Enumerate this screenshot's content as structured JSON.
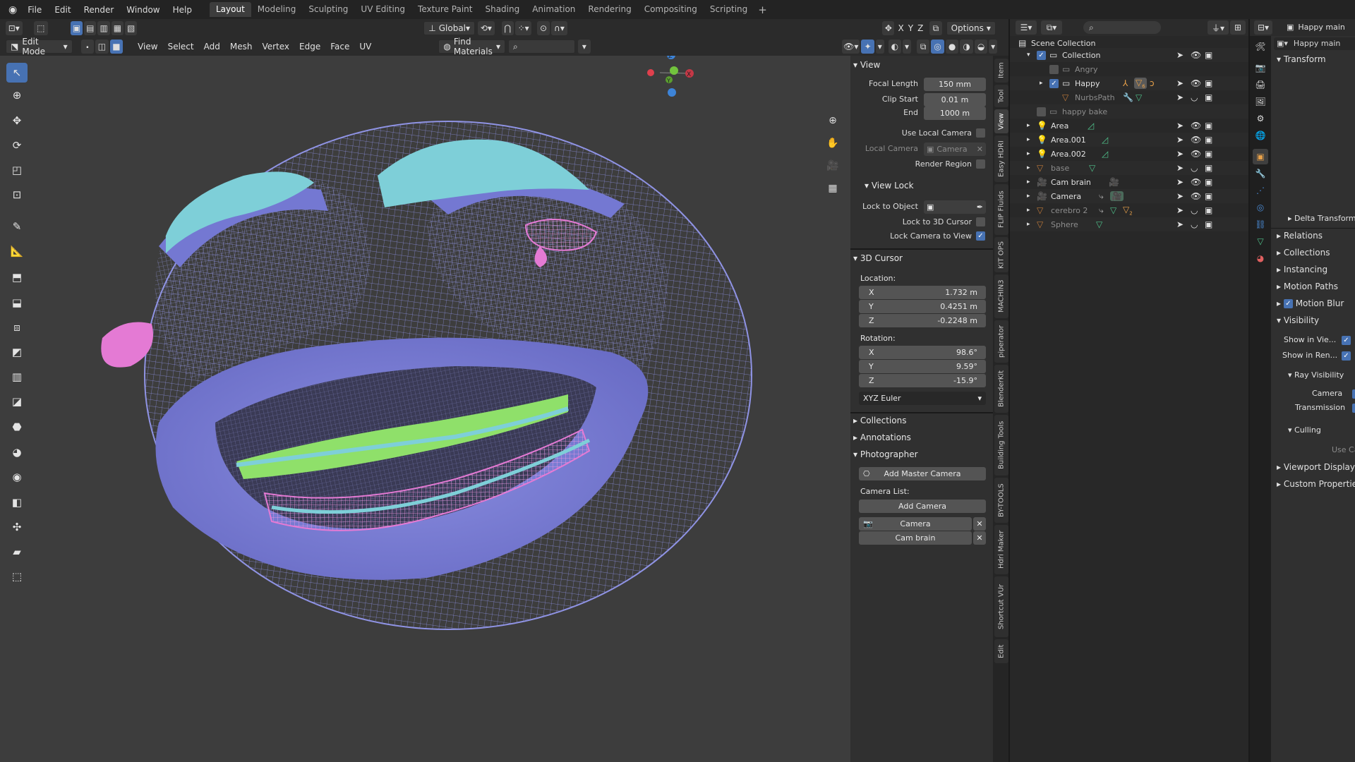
{
  "topbar": {
    "menus": [
      "File",
      "Edit",
      "Render",
      "Window",
      "Help"
    ],
    "workspaces": [
      "Layout",
      "Modeling",
      "Sculpting",
      "UV Editing",
      "Texture Paint",
      "Shading",
      "Animation",
      "Rendering",
      "Compositing",
      "Scripting"
    ],
    "active_workspace": "Layout",
    "add_tab": "+"
  },
  "viewport_header": {
    "mode": "Edit Mode",
    "menus": [
      "View",
      "Select",
      "Add",
      "Mesh",
      "Vertex",
      "Edge",
      "Face",
      "UV"
    ],
    "transform_orientation": "Global",
    "find_materials": "Find Materials",
    "axes": [
      "X",
      "Y",
      "Z"
    ],
    "options": "Options"
  },
  "gizmo": {
    "x": "X",
    "y": "Y",
    "z": "Z"
  },
  "npanel": {
    "view": {
      "title": "View",
      "focal_length_label": "Focal Length",
      "focal_length": "150 mm",
      "clip_start_label": "Clip Start",
      "clip_start": "0.01 m",
      "end_label": "End",
      "end": "1000 m",
      "use_local_camera": "Use Local Camera",
      "local_camera_label": "Local Camera",
      "local_camera": "Camera",
      "render_region": "Render Region",
      "view_lock": "View Lock",
      "lock_to_object": "Lock to Object",
      "lock_to_3d_cursor": "Lock to 3D Cursor",
      "lock_camera_to_view": "Lock Camera to View"
    },
    "cursor": {
      "title": "3D Cursor",
      "location": "Location:",
      "loc": [
        {
          "axis": "X",
          "value": "1.732 m"
        },
        {
          "axis": "Y",
          "value": "0.4251 m"
        },
        {
          "axis": "Z",
          "value": "-0.2248 m"
        }
      ],
      "rotation": "Rotation:",
      "rot": [
        {
          "axis": "X",
          "value": "98.6°"
        },
        {
          "axis": "Y",
          "value": "9.59°"
        },
        {
          "axis": "Z",
          "value": "-15.9°"
        }
      ],
      "mode": "XYZ Euler"
    },
    "collections": "Collections",
    "annotations": "Annotations",
    "photographer": {
      "title": "Photographer",
      "add_master": "Add Master Camera",
      "camera_list": "Camera List:",
      "add_camera": "Add Camera",
      "cameras": [
        "Camera",
        "Cam brain"
      ]
    }
  },
  "vtabs": [
    "Item",
    "Tool",
    "View",
    "Easy HDRI",
    "FLIP Fluids",
    "KIT OPS",
    "MACHIN3",
    "piperator",
    "BlenderKit",
    "Building Tools",
    "BY-TOOLS",
    "Hdri Maker",
    "Shortcut VUr",
    "Edit"
  ],
  "outliner": {
    "rows": [
      {
        "name": "Scene Collection",
        "dim": false
      },
      {
        "name": "Collection",
        "dim": false
      },
      {
        "name": "Angry",
        "dim": true
      },
      {
        "name": "Happy",
        "dim": false
      },
      {
        "name": "NurbsPath",
        "dim": true
      },
      {
        "name": "happy bake",
        "dim": true
      },
      {
        "name": "Area",
        "dim": false
      },
      {
        "name": "Area.001",
        "dim": false
      },
      {
        "name": "Area.002",
        "dim": false
      },
      {
        "name": "base",
        "dim": true
      },
      {
        "name": "Cam brain",
        "dim": false
      },
      {
        "name": "Camera",
        "dim": false
      },
      {
        "name": "cerebro 2",
        "dim": true
      },
      {
        "name": "Sphere",
        "dim": true
      }
    ],
    "badges": {
      "happy_count": "6",
      "cerebro_count": "2"
    }
  },
  "properties": {
    "header_object": "Happy main",
    "object_name": "Happy main",
    "sections": {
      "transform": "Transform",
      "delta_transform": "Delta Transform",
      "relations": "Relations",
      "collections": "Collections",
      "instancing": "Instancing",
      "motion_paths": "Motion Paths",
      "motion_blur": "Motion Blur",
      "visibility": "Visibility",
      "show_in_viewport": "Show in Vie...",
      "show_in_renders": "Show in Ren...",
      "ray_visibility": "Ray Visibility",
      "camera": "Camera",
      "transmission": "Transmission",
      "culling": "Culling",
      "use_camera": "Use Ca",
      "viewport_display": "Viewport Display",
      "custom_properties": "Custom Properties"
    }
  },
  "colors": {
    "accent": "#4772b3",
    "mesh_blue": "#7c7fd6",
    "wire": "#8b8fe0",
    "teal": "#7ecfd8",
    "pink": "#e47ad4",
    "green": "#8fe06a"
  }
}
